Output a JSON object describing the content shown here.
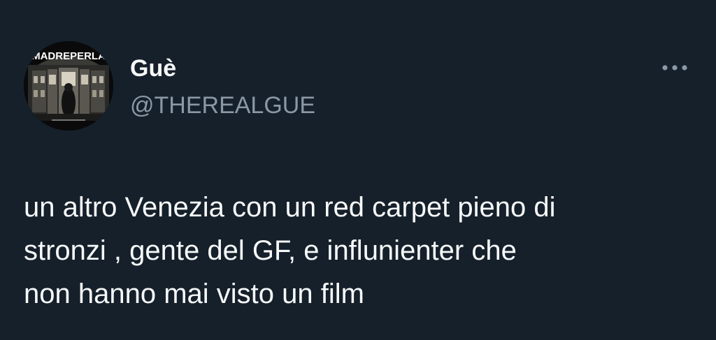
{
  "author": {
    "display_name": "Guè",
    "handle": "@THEREALGUE",
    "avatar_text": "MADREPERLA"
  },
  "menu": {
    "icon": "more-horizontal-icon"
  },
  "tweet": {
    "lines": [
      "un altro Venezia con un red carpet pieno di",
      "stronzi , gente del GF, e influnienter che",
      "non hanno mai visto un film"
    ]
  },
  "colors": {
    "background": "#15202b",
    "primary_text": "#f7f9f9",
    "secondary_text": "#8b98a5"
  }
}
